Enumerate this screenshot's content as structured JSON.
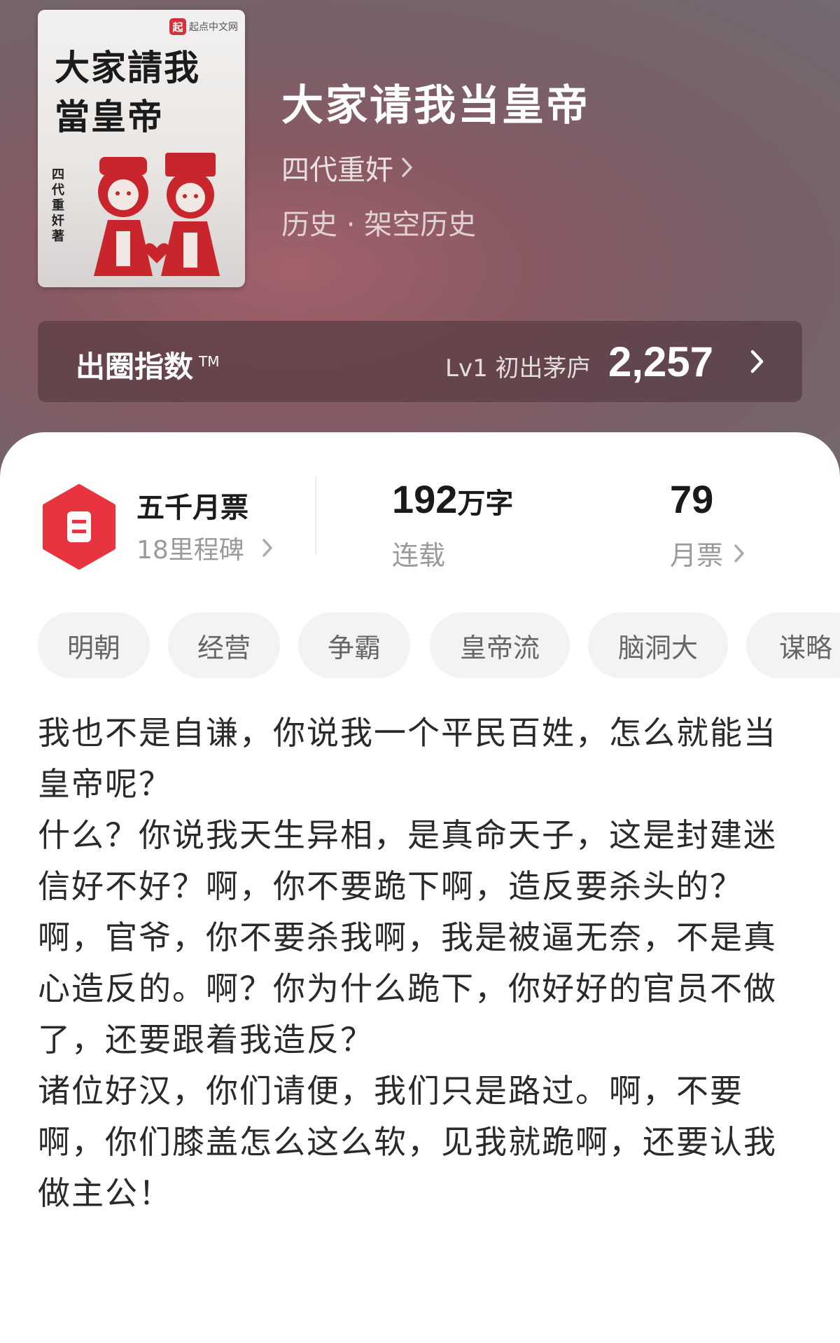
{
  "book": {
    "cover": {
      "badge_text": "起点中文网",
      "badge_icon": "qidian-logo",
      "title": "大家請我當皇帝",
      "author_vertical": "四代重奸著"
    },
    "title": "大家请我当皇帝",
    "author": "四代重奸",
    "genre": "历史 · 架空历史"
  },
  "index": {
    "label": "出圈指数",
    "tm": "TM",
    "level": "Lv1 初出茅庐",
    "value": "2,257"
  },
  "stats": {
    "milestone_title": "五千月票",
    "milestone_sub": "18里程碑",
    "words_number": "192",
    "words_unit": "万字",
    "status": "连载",
    "votes_number": "79",
    "votes_label": "月票"
  },
  "tags": [
    "明朝",
    "经营",
    "争霸",
    "皇帝流",
    "脑洞大",
    "谋略"
  ],
  "intro": [
    "我也不是自谦，你说我一个平民百姓，怎么就能当皇帝呢？",
    "什么？你说我天生异相，是真命天子，这是封建迷信好不好？啊，你不要跪下啊，造反要杀头的？",
    "啊，官爷，你不要杀我啊，我是被逼无奈，不是真心造反的。啊？你为什么跪下，你好好的官员不做了，还要跟着我造反？",
    "诸位好汉，你们请便，我们只是路过。啊，不要啊，你们膝盖怎么这么软，见我就跪啊，还要认我做主公！"
  ],
  "colors": {
    "hero": "#8a5a63",
    "badge_red": "#e8343e",
    "tag_bg": "#f3f3f3"
  }
}
